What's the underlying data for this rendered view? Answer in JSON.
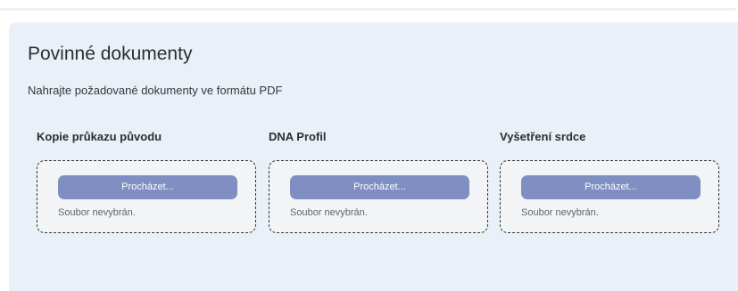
{
  "section": {
    "title": "Povinné dokumenty",
    "subtitle": "Nahrajte požadované dokumenty ve formátu PDF"
  },
  "documents": [
    {
      "label": "Kopie průkazu původu",
      "button_label": "Procházet...",
      "file_status": "Soubor nevybrán."
    },
    {
      "label": "DNA Profil",
      "button_label": "Procházet...",
      "file_status": "Soubor nevybrán."
    },
    {
      "label": "Vyšetření srdce",
      "button_label": "Procházet...",
      "file_status": "Soubor nevybrán."
    }
  ],
  "colors": {
    "section_background": "#eaf0f7",
    "button_background": "#7f8fc2",
    "dropzone_background": "#f3f4f6"
  }
}
